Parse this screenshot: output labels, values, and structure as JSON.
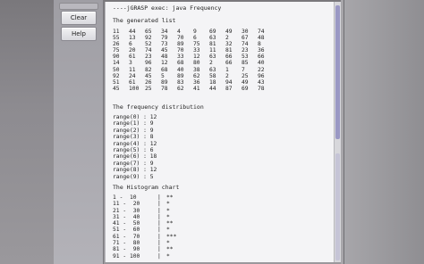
{
  "buttons": {
    "clear": "Clear",
    "help": "Help"
  },
  "console": {
    "command": "----jGRASP exec: java Frequency",
    "generated_heading": "The generated list",
    "numbers": [
      [
        11,
        44,
        65,
        34,
        4,
        9,
        69,
        49,
        30,
        74
      ],
      [
        55,
        13,
        92,
        79,
        70,
        6,
        63,
        2,
        67,
        48
      ],
      [
        26,
        6,
        52,
        73,
        89,
        75,
        81,
        32,
        74,
        8
      ],
      [
        75,
        20,
        74,
        45,
        70,
        33,
        11,
        81,
        23,
        36
      ],
      [
        90,
        61,
        23,
        48,
        33,
        12,
        63,
        66,
        53,
        66
      ],
      [
        14,
        3,
        96,
        12,
        68,
        80,
        2,
        66,
        85,
        40
      ],
      [
        50,
        11,
        82,
        68,
        40,
        38,
        63,
        1,
        7,
        22
      ],
      [
        92,
        24,
        45,
        5,
        89,
        62,
        58,
        2,
        25,
        96
      ],
      [
        51,
        61,
        26,
        89,
        83,
        36,
        18,
        94,
        49,
        43
      ],
      [
        45,
        100,
        25,
        78,
        62,
        41,
        44,
        87,
        69,
        78
      ]
    ],
    "frequency_heading": "The frequency distribution",
    "frequency": [
      "range(0) : 12",
      "range(1) : 9",
      "range(2) : 9",
      "range(3) : 8",
      "range(4) : 12",
      "range(5) : 6",
      "range(6) : 18",
      "range(7) : 9",
      "range(8) : 12",
      "range(9) : 5"
    ],
    "histogram_heading": "The Histogram chart",
    "histogram": [
      {
        "range": "1 -  10",
        "bar": "**"
      },
      {
        "range": "11 -  20",
        "bar": "*"
      },
      {
        "range": "21 -  30",
        "bar": "*"
      },
      {
        "range": "31 -  40",
        "bar": "*"
      },
      {
        "range": "41 -  50",
        "bar": "**"
      },
      {
        "range": "51 -  60",
        "bar": "*"
      },
      {
        "range": "61 -  70",
        "bar": "***"
      },
      {
        "range": "71 -  80",
        "bar": "*"
      },
      {
        "range": "81 -  90",
        "bar": "**"
      },
      {
        "range": "91 - 100",
        "bar": "*"
      }
    ]
  }
}
